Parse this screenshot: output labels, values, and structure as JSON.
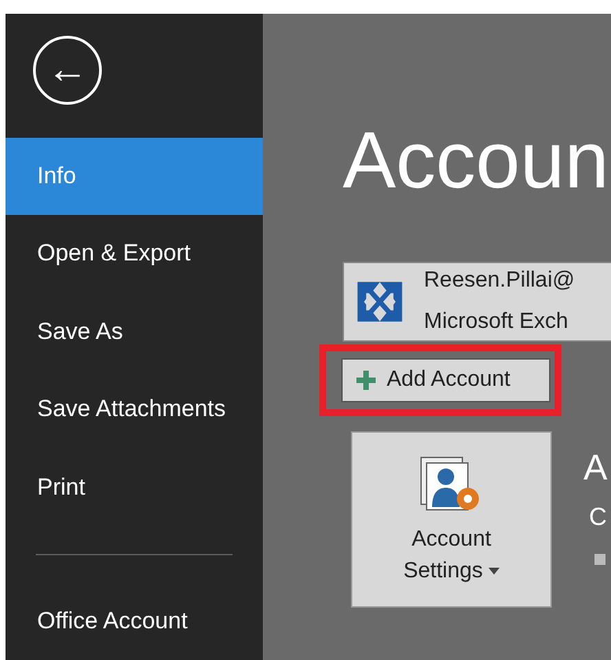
{
  "sidebar": {
    "back": "←",
    "items": [
      {
        "label": "Info",
        "selected": true
      },
      {
        "label": "Open & Export",
        "selected": false
      },
      {
        "label": "Save As",
        "selected": false
      },
      {
        "label": "Save Attachments",
        "selected": false
      },
      {
        "label": "Print",
        "selected": false
      },
      {
        "label": "Office Account",
        "selected": false,
        "divider_before": true
      }
    ]
  },
  "content": {
    "title": "Accoun",
    "account": {
      "email": "Reesen.Pillai@",
      "type": "Microsoft Exch"
    },
    "add_account": {
      "label": "Add Account",
      "highlighted": true
    },
    "settings_tile": {
      "line1": "Account",
      "line2": "Settings"
    },
    "side_heading": "A",
    "side_text": "C"
  }
}
